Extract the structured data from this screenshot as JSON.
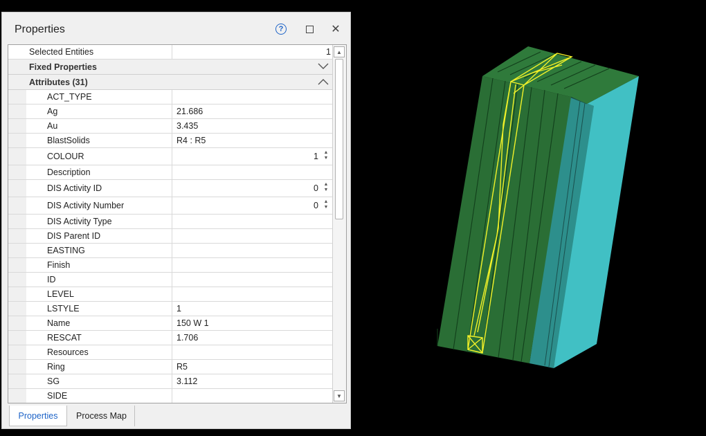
{
  "panel": {
    "title": "Properties",
    "help_glyph": "?",
    "close_glyph": "✕"
  },
  "selected": {
    "label": "Selected Entities",
    "value": "1"
  },
  "groups": {
    "fixed": "Fixed Properties",
    "attributes": "Attributes (31)"
  },
  "attributes": [
    {
      "name": "ACT_TYPE",
      "value": ""
    },
    {
      "name": "Ag",
      "value": "21.686"
    },
    {
      "name": "Au",
      "value": "3.435"
    },
    {
      "name": "BlastSolids",
      "value": "R4 : R5"
    },
    {
      "name": "COLOUR",
      "value": "1"
    },
    {
      "name": "Description",
      "value": ""
    },
    {
      "name": "DIS Activity ID",
      "value": "0"
    },
    {
      "name": "DIS Activity Number",
      "value": "0"
    },
    {
      "name": "DIS Activity Type",
      "value": ""
    },
    {
      "name": "DIS Parent ID",
      "value": ""
    },
    {
      "name": "EASTING",
      "value": ""
    },
    {
      "name": "Finish",
      "value": ""
    },
    {
      "name": "ID",
      "value": ""
    },
    {
      "name": "LEVEL",
      "value": ""
    },
    {
      "name": "LSTYLE",
      "value": "1"
    },
    {
      "name": "Name",
      "value": "150 W 1"
    },
    {
      "name": "RESCAT",
      "value": "1.706"
    },
    {
      "name": "Resources",
      "value": ""
    },
    {
      "name": "Ring",
      "value": "R5"
    },
    {
      "name": "SG",
      "value": "3.112"
    },
    {
      "name": "SIDE",
      "value": ""
    }
  ],
  "tabs": [
    {
      "label": "Properties"
    },
    {
      "label": "Process Map"
    }
  ],
  "colors": {
    "accent": "#1e64c8",
    "solid_green": "#2a6e35",
    "solid_teal": "#2d8f8c",
    "solid_cyan": "#41c0c4",
    "highlight": "#f2f229"
  }
}
